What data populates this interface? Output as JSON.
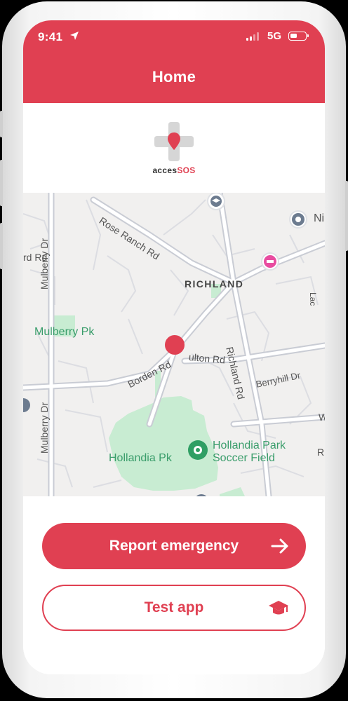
{
  "status_bar": {
    "time": "9:41",
    "network": "5G"
  },
  "header": {
    "title": "Home"
  },
  "logo": {
    "text_prefix": "acces",
    "text_accent": "SOS"
  },
  "map": {
    "labels": {
      "rose_ranch": "Rose Ranch Rd",
      "richland_area": "RICHLAND",
      "mulberry_dr_top": "Mulberry Dr",
      "mulberry_dr_bottom": "Mulberry Dr",
      "rd_left": "rd Rd",
      "mulberry_pk": "Mulberry Pk",
      "borden": "Borden Rd",
      "fulton": "ulton Rd",
      "richland_rd": "Richland Rd",
      "berryhill": "Berryhill Dr",
      "hollandia_pk": "Hollandia Pk",
      "hollandia_field_1": "Hollandia Park",
      "hollandia_field_2": "Soccer Field",
      "ni": "Ni",
      "lac": "Lac",
      "w": "W",
      "r": "R"
    }
  },
  "actions": {
    "report_label": "Report emergency",
    "test_label": "Test app"
  },
  "colors": {
    "brand": "#e04052",
    "park": "#c8ecd2",
    "road": "#ffffff"
  },
  "icons": {
    "report": "arrow-right-icon",
    "test": "graduation-cap-icon",
    "location": "location-arrow-icon"
  }
}
